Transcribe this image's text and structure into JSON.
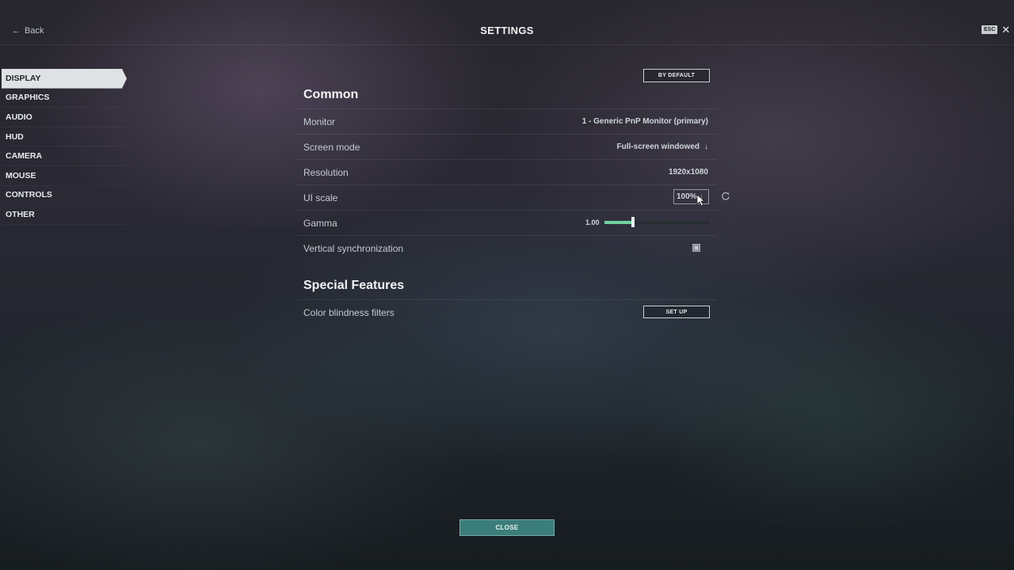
{
  "header": {
    "back_label": "Back",
    "title": "SETTINGS",
    "esc_key": "ESC"
  },
  "sidebar": {
    "items": [
      {
        "label": "DISPLAY",
        "active": true
      },
      {
        "label": "GRAPHICS",
        "active": false
      },
      {
        "label": "AUDIO",
        "active": false
      },
      {
        "label": "HUD",
        "active": false
      },
      {
        "label": "CAMERA",
        "active": false
      },
      {
        "label": "MOUSE",
        "active": false
      },
      {
        "label": "CONTROLS",
        "active": false
      },
      {
        "label": "OTHER",
        "active": false
      }
    ]
  },
  "settings": {
    "by_default_label": "BY DEFAULT",
    "common_title": "Common",
    "monitor": {
      "label": "Monitor",
      "value": "1 - Generic PnP Monitor (primary)"
    },
    "screen_mode": {
      "label": "Screen mode",
      "value": "Full-screen windowed"
    },
    "resolution": {
      "label": "Resolution",
      "value": "1920x1080"
    },
    "ui_scale": {
      "label": "UI scale",
      "value": "100%"
    },
    "gamma": {
      "label": "Gamma",
      "value": "1.00",
      "slider_fraction": 0.27
    },
    "vsync": {
      "label": "Vertical synchronization",
      "checked": false
    },
    "special_title": "Special Features",
    "color_blindness": {
      "label": "Color blindness filters",
      "button": "SET UP"
    }
  },
  "footer": {
    "close_label": "CLOSE"
  },
  "colors": {
    "accent_green": "#6fd4a0",
    "close_button": "#3b7d7a",
    "active_tab_bg": "#dfe2e4"
  }
}
